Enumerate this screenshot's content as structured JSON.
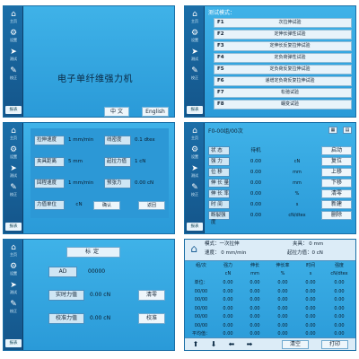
{
  "sidebar": {
    "items": [
      {
        "icon": "house-icon",
        "glyph": "⌂",
        "label": "主页"
      },
      {
        "icon": "gear-icon",
        "glyph": "⚙",
        "label": "设置"
      },
      {
        "icon": "send-icon",
        "glyph": "➤",
        "label": "测试"
      },
      {
        "icon": "pencil-icon",
        "glyph": "✎",
        "label": "校正"
      }
    ],
    "help": "报表"
  },
  "home": {
    "title": "电子单纤维强力机",
    "lang_cn": "中  文",
    "lang_en": "English"
  },
  "modes": {
    "title": "测试模式：",
    "items": [
      {
        "code": "F1",
        "name": "次拉伸试验"
      },
      {
        "code": "F2",
        "name": "定伸长弹性试验"
      },
      {
        "code": "F3",
        "name": "定伸长反复拉伸试验"
      },
      {
        "code": "F4",
        "name": "定负荷弹性试验"
      },
      {
        "code": "F5",
        "name": "定负荷反复拉伸试验"
      },
      {
        "code": "F6",
        "name": "递增定负荷反复拉伸试验"
      },
      {
        "code": "F7",
        "name": "松弛试验"
      },
      {
        "code": "F8",
        "name": "蠕变试验"
      }
    ]
  },
  "params": {
    "rows": [
      {
        "l1": "拉伸速度",
        "v1": "1  mm/min",
        "l2": "线密度",
        "v2": "0.1  dtex"
      },
      {
        "l1": "夹具距离",
        "v1": "5    mm",
        "l2": "起拉力值",
        "v2": "1    cN"
      },
      {
        "l1": "回程速度",
        "v1": "1  mm/min",
        "l2": "预张力",
        "v2": "0.00  cN"
      },
      {
        "l1": "力值单位",
        "v1": "cN"
      }
    ],
    "confirm": "确认",
    "exit": "返回"
  },
  "test": {
    "header": "F0-00组/00次",
    "rows": [
      {
        "label": "状    态",
        "value": "待机",
        "unit": ""
      },
      {
        "label": "强    力",
        "value": "0.00",
        "unit": "cN"
      },
      {
        "label": "位    移",
        "value": "0.00",
        "unit": "mm"
      },
      {
        "label": "伸 长 量",
        "value": "0.00",
        "unit": "mm"
      },
      {
        "label": "伸 长 率",
        "value": "0.00",
        "unit": "%"
      },
      {
        "label": "时    间",
        "value": "0.00",
        "unit": "s"
      },
      {
        "label": "断裂强度",
        "value": "0.00",
        "unit": "cN/dtex"
      }
    ],
    "buttons": [
      "启动",
      "复位",
      "上移",
      "下移",
      "清零",
      "新建",
      "删除"
    ]
  },
  "calib": {
    "title": "标定",
    "ad_label": "AD",
    "ad_value": "00000",
    "real_label": "实时力值",
    "real_value": "0.00  cN",
    "zero_btn": "清零",
    "cal_label": "校准力值",
    "cal_value": "0.00  cN",
    "cal_btn": "校准"
  },
  "report": {
    "mode_line": "模式：一次拉伸",
    "clamp_line": "夹具：   0    mm",
    "speed_line": "速度：   0   mm/min",
    "start_line": "起拉力值：0    cN",
    "headers": [
      "组/次",
      "强力",
      "伸长",
      "伸长率",
      "时间",
      "强度"
    ],
    "units": [
      "",
      "cN",
      "mm",
      "%",
      "s",
      "cN/dtex"
    ],
    "rows": [
      [
        "单位：",
        "0.00",
        "0.00",
        "0.00",
        "0.00",
        "0.00"
      ],
      [
        "00/00",
        "0.00",
        "0.00",
        "0.00",
        "0.00",
        "0.00"
      ],
      [
        "00/00",
        "0.00",
        "0.00",
        "0.00",
        "0.00",
        "0.00"
      ],
      [
        "00/00",
        "0.00",
        "0.00",
        "0.00",
        "0.00",
        "0.00"
      ],
      [
        "00/00",
        "0.00",
        "0.00",
        "0.00",
        "0.00",
        "0.00"
      ],
      [
        "00/00",
        "0.00",
        "0.00",
        "0.00",
        "0.00",
        "0.00"
      ],
      [
        "平均值：",
        "0.00",
        "0.00",
        "0.00",
        "0.00",
        "0.00"
      ]
    ],
    "clear": "清空",
    "print": "打印"
  }
}
